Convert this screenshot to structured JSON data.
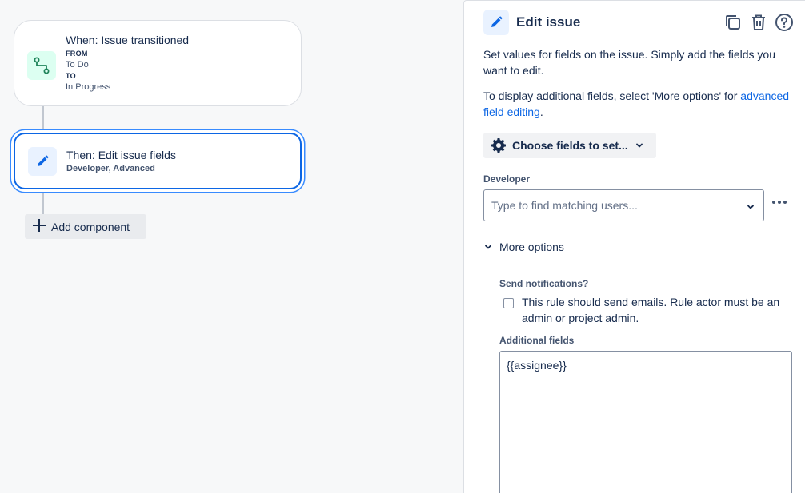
{
  "canvas": {
    "trigger": {
      "title": "When: Issue transitioned",
      "from_label": "FROM",
      "from_value": "To Do",
      "to_label": "TO",
      "to_value": "In Progress",
      "icon": "transition-icon",
      "icon_color": "#1f845a"
    },
    "action": {
      "title": "Then: Edit issue fields",
      "subtitle": "Developer, Advanced",
      "icon": "pencil-icon",
      "icon_color": "#0c66e4"
    },
    "add_component_label": "Add component"
  },
  "panel": {
    "title": "Edit issue",
    "header_actions": [
      "copy-icon",
      "trash-icon",
      "help-icon"
    ],
    "description": "Set values for fields on the issue. Simply add the fields you want to edit.",
    "additional_prefix": "To display additional fields, select 'More options' for",
    "additional_link": "advanced field editing",
    "additional_suffix": ".",
    "choose_fields_label": "Choose fields to set...",
    "developer_label": "Developer",
    "developer_placeholder": "Type to find matching users...",
    "more_options_label": "More options",
    "send_notifications_label": "Send notifications?",
    "send_notifications_text": "This rule should send emails. Rule actor must be an admin or project admin.",
    "send_notifications_checked": false,
    "additional_fields_label": "Additional fields",
    "additional_fields_value": "{{assignee}}"
  },
  "colors": {
    "accent": "#0c66e4",
    "selection_ring": "#388bff",
    "trigger_icon_bg": "#dcfff1",
    "action_icon_bg": "#e9f2ff"
  }
}
